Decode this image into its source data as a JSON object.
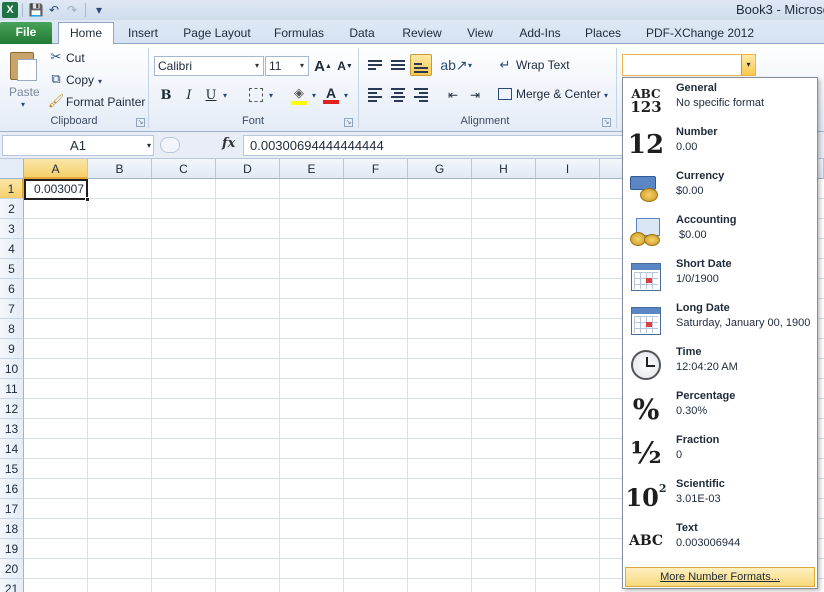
{
  "titlebar": {
    "title": "Book3 - Microso",
    "excel_glyph": "X",
    "save_glyph": "💾",
    "undo_glyph": "↶",
    "redo_glyph": "↷",
    "customize_glyph": "▾"
  },
  "tabs": [
    {
      "id": "file",
      "label": "File"
    },
    {
      "id": "home",
      "label": "Home"
    },
    {
      "id": "insert",
      "label": "Insert"
    },
    {
      "id": "page-layout",
      "label": "Page Layout"
    },
    {
      "id": "formulas",
      "label": "Formulas"
    },
    {
      "id": "data",
      "label": "Data"
    },
    {
      "id": "review",
      "label": "Review"
    },
    {
      "id": "view",
      "label": "View"
    },
    {
      "id": "add-ins",
      "label": "Add-Ins"
    },
    {
      "id": "places",
      "label": "Places"
    },
    {
      "id": "pdf-xchange",
      "label": "PDF-XChange 2012"
    }
  ],
  "clipboard": {
    "group_label": "Clipboard",
    "paste_label": "Paste",
    "cut_label": "Cut",
    "copy_label": "Copy",
    "format_painter_label": "Format Painter"
  },
  "font": {
    "group_label": "Font",
    "font_name": "Calibri",
    "font_size": "11",
    "bold": "B",
    "italic": "I",
    "underline": "U",
    "grow_glyph": "A",
    "shrink_glyph": "A",
    "font_color_glyph": "A"
  },
  "alignment": {
    "group_label": "Alignment",
    "wrap_text_label": "Wrap Text",
    "merge_center_label": "Merge & Center"
  },
  "formula_bar": {
    "name_box": "A1",
    "fx_label": "fx",
    "formula_value": "0.00300694444444444"
  },
  "sheet": {
    "columns": [
      "A",
      "B",
      "C",
      "D",
      "E",
      "F",
      "G",
      "H",
      "I"
    ],
    "rows": [
      "1",
      "2",
      "3",
      "4",
      "5",
      "6",
      "7",
      "8",
      "9",
      "10",
      "11",
      "12",
      "13",
      "14",
      "15",
      "16",
      "17",
      "18",
      "19",
      "20",
      "21"
    ],
    "selected_cell": "A1",
    "a1_value": "0.003007"
  },
  "number_format_menu": {
    "items": [
      {
        "id": "general",
        "name": "General",
        "sample": "No specific format",
        "icon": "abc-123-icon"
      },
      {
        "id": "number",
        "name": "Number",
        "sample": "0.00",
        "icon": "number-12-icon"
      },
      {
        "id": "currency",
        "name": "Currency",
        "sample": "$0.00",
        "icon": "currency-icon"
      },
      {
        "id": "accounting",
        "name": "Accounting",
        "sample": " $0.00",
        "icon": "accounting-icon"
      },
      {
        "id": "short-date",
        "name": "Short Date",
        "sample": "1/0/1900",
        "icon": "calendar-icon"
      },
      {
        "id": "long-date",
        "name": "Long Date",
        "sample": "Saturday, January 00, 1900",
        "icon": "calendar-icon"
      },
      {
        "id": "time",
        "name": "Time",
        "sample": "12:04:20 AM",
        "icon": "clock-icon"
      },
      {
        "id": "percentage",
        "name": "Percentage",
        "sample": "0.30%",
        "icon": "percent-icon"
      },
      {
        "id": "fraction",
        "name": "Fraction",
        "sample": "0",
        "icon": "fraction-icon"
      },
      {
        "id": "scientific",
        "name": "Scientific",
        "sample": "3.01E-03",
        "icon": "scientific-icon"
      },
      {
        "id": "text",
        "name": "Text",
        "sample": "0.003006944",
        "icon": "abc-icon"
      }
    ],
    "icon_text": {
      "abc": "ABC",
      "n123": "123",
      "twelve": "12",
      "percent": "%",
      "half": "½",
      "ten": "10",
      "exp": "2"
    },
    "more_label": "More Number Formats..."
  }
}
